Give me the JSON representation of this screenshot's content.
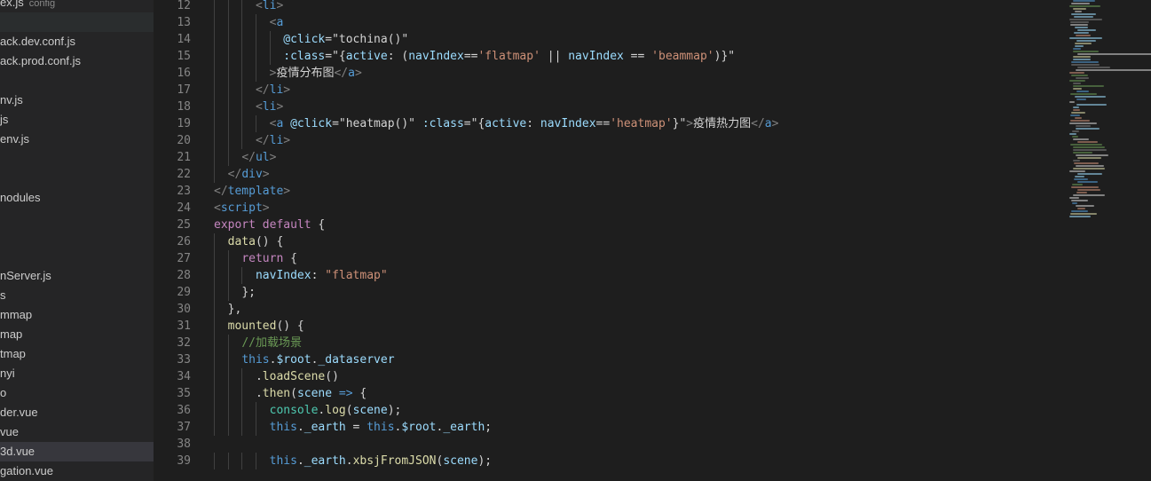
{
  "sidebar": {
    "items": [
      {
        "label": "ex.js",
        "desc": "config"
      },
      {
        "label": "",
        "desc": ""
      },
      {
        "label": "ack.dev.conf.js",
        "desc": ""
      },
      {
        "label": "ack.prod.conf.js",
        "desc": ""
      },
      {
        "label": "",
        "desc": ""
      },
      {
        "label": "nv.js",
        "desc": ""
      },
      {
        "label": "js",
        "desc": ""
      },
      {
        "label": "env.js",
        "desc": ""
      },
      {
        "label": "",
        "desc": ""
      },
      {
        "label": "",
        "desc": ""
      },
      {
        "label": "nodules",
        "desc": ""
      },
      {
        "label": "",
        "desc": ""
      },
      {
        "label": "",
        "desc": ""
      },
      {
        "label": "",
        "desc": ""
      },
      {
        "label": "nServer.js",
        "desc": ""
      },
      {
        "label": "s",
        "desc": ""
      },
      {
        "label": "mmap",
        "desc": ""
      },
      {
        "label": "map",
        "desc": ""
      },
      {
        "label": "tmap",
        "desc": ""
      },
      {
        "label": "nyi",
        "desc": ""
      },
      {
        "label": "o",
        "desc": ""
      },
      {
        "label": "der.vue",
        "desc": ""
      },
      {
        "label": "vue",
        "desc": ""
      },
      {
        "label": "3d.vue",
        "desc": ""
      },
      {
        "label": "gation.vue",
        "desc": ""
      }
    ]
  },
  "editor": {
    "lines": [
      {
        "n": "12",
        "indent": 3,
        "tokens": [
          [
            "<",
            "br"
          ],
          [
            "li",
            "tag"
          ],
          [
            ">",
            "br"
          ]
        ]
      },
      {
        "n": "13",
        "indent": 4,
        "tokens": [
          [
            "<",
            "br"
          ],
          [
            "a",
            "tag"
          ]
        ]
      },
      {
        "n": "14",
        "indent": 5,
        "tokens": [
          [
            "@click",
            "attr"
          ],
          [
            "=",
            "txt"
          ],
          [
            "\"tochina()\"",
            "txt"
          ]
        ]
      },
      {
        "n": "15",
        "indent": 5,
        "tokens": [
          [
            ":class",
            "attr"
          ],
          [
            "=\"{",
            "txt"
          ],
          [
            "active",
            "attr"
          ],
          [
            ": (",
            "txt"
          ],
          [
            "navIndex",
            "attr"
          ],
          [
            "==",
            "txt"
          ],
          [
            "'flatmap'",
            "str"
          ],
          [
            " || ",
            "txt"
          ],
          [
            "navIndex",
            "attr"
          ],
          [
            " == ",
            "txt"
          ],
          [
            "'beammap'",
            "str"
          ],
          [
            ")}\"",
            "txt"
          ]
        ]
      },
      {
        "n": "16",
        "indent": 4,
        "tokens": [
          [
            ">",
            "br"
          ],
          [
            "疫情分布图",
            "txt"
          ],
          [
            "</",
            "br"
          ],
          [
            "a",
            "tag"
          ],
          [
            ">",
            "br"
          ]
        ]
      },
      {
        "n": "17",
        "indent": 3,
        "tokens": [
          [
            "</",
            "br"
          ],
          [
            "li",
            "tag"
          ],
          [
            ">",
            "br"
          ]
        ]
      },
      {
        "n": "18",
        "indent": 3,
        "tokens": [
          [
            "<",
            "br"
          ],
          [
            "li",
            "tag"
          ],
          [
            ">",
            "br"
          ]
        ]
      },
      {
        "n": "19",
        "indent": 4,
        "tokens": [
          [
            "<",
            "br"
          ],
          [
            "a",
            "tag"
          ],
          [
            " ",
            "txt"
          ],
          [
            "@click",
            "attr"
          ],
          [
            "=",
            "txt"
          ],
          [
            "\"heatmap()\"",
            "txt"
          ],
          [
            " ",
            "txt"
          ],
          [
            ":class",
            "attr"
          ],
          [
            "=\"{",
            "txt"
          ],
          [
            "active",
            "attr"
          ],
          [
            ": ",
            "txt"
          ],
          [
            "navIndex",
            "attr"
          ],
          [
            "==",
            "txt"
          ],
          [
            "'heatmap'",
            "str"
          ],
          [
            "}\"",
            "txt"
          ],
          [
            ">",
            "br"
          ],
          [
            "疫情热力图",
            "txt"
          ],
          [
            "</",
            "br"
          ],
          [
            "a",
            "tag"
          ],
          [
            ">",
            "br"
          ]
        ]
      },
      {
        "n": "20",
        "indent": 3,
        "tokens": [
          [
            "</",
            "br"
          ],
          [
            "li",
            "tag"
          ],
          [
            ">",
            "br"
          ]
        ]
      },
      {
        "n": "21",
        "indent": 2,
        "tokens": [
          [
            "</",
            "br"
          ],
          [
            "ul",
            "tag"
          ],
          [
            ">",
            "br"
          ]
        ]
      },
      {
        "n": "22",
        "indent": 1,
        "tokens": [
          [
            "</",
            "br"
          ],
          [
            "div",
            "tag"
          ],
          [
            ">",
            "br"
          ]
        ]
      },
      {
        "n": "23",
        "indent": 0,
        "tokens": [
          [
            "</",
            "br"
          ],
          [
            "template",
            "tag"
          ],
          [
            ">",
            "br"
          ]
        ]
      },
      {
        "n": "24",
        "indent": 0,
        "tokens": [
          [
            "<",
            "br"
          ],
          [
            "script",
            "tag"
          ],
          [
            ">",
            "br"
          ]
        ]
      },
      {
        "n": "25",
        "indent": 0,
        "tokens": [
          [
            "export",
            "ctl"
          ],
          [
            " ",
            "txt"
          ],
          [
            "default",
            "ctl"
          ],
          [
            " {",
            "txt"
          ]
        ]
      },
      {
        "n": "26",
        "indent": 1,
        "tokens": [
          [
            "data",
            "fn"
          ],
          [
            "() {",
            "txt"
          ]
        ]
      },
      {
        "n": "27",
        "indent": 2,
        "tokens": [
          [
            "return",
            "ctl"
          ],
          [
            " {",
            "txt"
          ]
        ]
      },
      {
        "n": "28",
        "indent": 3,
        "tokens": [
          [
            "navIndex",
            "var"
          ],
          [
            ": ",
            "txt"
          ],
          [
            "\"flatmap\"",
            "str"
          ]
        ]
      },
      {
        "n": "29",
        "indent": 2,
        "tokens": [
          [
            "};",
            "txt"
          ]
        ]
      },
      {
        "n": "30",
        "indent": 1,
        "tokens": [
          [
            "},",
            "txt"
          ]
        ]
      },
      {
        "n": "31",
        "indent": 1,
        "tokens": [
          [
            "mounted",
            "fn"
          ],
          [
            "() {",
            "txt"
          ]
        ]
      },
      {
        "n": "32",
        "indent": 2,
        "tokens": [
          [
            "//加载场景",
            "cm"
          ]
        ]
      },
      {
        "n": "33",
        "indent": 2,
        "tokens": [
          [
            "this",
            "kw"
          ],
          [
            ".",
            "txt"
          ],
          [
            "$root",
            "var"
          ],
          [
            ".",
            "txt"
          ],
          [
            "_dataserver",
            "var"
          ]
        ]
      },
      {
        "n": "34",
        "indent": 3,
        "tokens": [
          [
            ".",
            "txt"
          ],
          [
            "loadScene",
            "fn"
          ],
          [
            "()",
            "txt"
          ]
        ]
      },
      {
        "n": "35",
        "indent": 3,
        "tokens": [
          [
            ".",
            "txt"
          ],
          [
            "then",
            "fn"
          ],
          [
            "(",
            "txt"
          ],
          [
            "scene",
            "var"
          ],
          [
            " ",
            "txt"
          ],
          [
            "=>",
            "kw"
          ],
          [
            " {",
            "txt"
          ]
        ]
      },
      {
        "n": "36",
        "indent": 4,
        "tokens": [
          [
            "console",
            "cls"
          ],
          [
            ".",
            "txt"
          ],
          [
            "log",
            "fn"
          ],
          [
            "(",
            "txt"
          ],
          [
            "scene",
            "var"
          ],
          [
            ");",
            "txt"
          ]
        ]
      },
      {
        "n": "37",
        "indent": 4,
        "tokens": [
          [
            "this",
            "kw"
          ],
          [
            ".",
            "txt"
          ],
          [
            "_earth",
            "var"
          ],
          [
            " = ",
            "txt"
          ],
          [
            "this",
            "kw"
          ],
          [
            ".",
            "txt"
          ],
          [
            "$root",
            "var"
          ],
          [
            ".",
            "txt"
          ],
          [
            "_earth",
            "var"
          ],
          [
            ";",
            "txt"
          ]
        ]
      },
      {
        "n": "38",
        "indent": 0,
        "tokens": []
      },
      {
        "n": "39",
        "indent": 4,
        "tokens": [
          [
            "this",
            "kw"
          ],
          [
            ".",
            "txt"
          ],
          [
            "_earth",
            "var"
          ],
          [
            ".",
            "txt"
          ],
          [
            "xbsjFromJSON",
            "fn"
          ],
          [
            "(",
            "txt"
          ],
          [
            "scene",
            "var"
          ],
          [
            ");",
            "txt"
          ]
        ]
      }
    ]
  },
  "colors": {
    "editor_bg": "#1e1e1e",
    "sidebar_bg": "#252526",
    "selection_bg": "#37373d",
    "tag": "#569cd6",
    "attribute": "#9cdcfe",
    "string": "#ce9178",
    "comment": "#6a9955",
    "function": "#dcdcaa",
    "control": "#c586c0"
  }
}
